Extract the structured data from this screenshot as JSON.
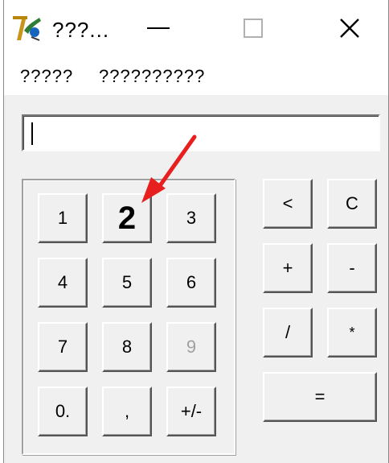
{
  "window": {
    "title": "???...",
    "icon": "app-logo-icon",
    "controls": {
      "minimize": "minimize-icon",
      "maximize": "maximize-icon",
      "close": "close-icon"
    }
  },
  "menubar": {
    "items": [
      "?????",
      "??????????"
    ]
  },
  "display": {
    "value": ""
  },
  "keypad": {
    "digits": [
      "1",
      "2",
      "3",
      "4",
      "5",
      "6",
      "7",
      "8",
      "9",
      "0.",
      ",",
      "+/-"
    ]
  },
  "operators": {
    "backspace": "<",
    "clear": "C",
    "plus": "+",
    "minus": "-",
    "divide": "/",
    "multiply": "*",
    "equals": "="
  },
  "colors": {
    "annotation_arrow": "#e81f1f",
    "window_bg": "#f0f0f0"
  }
}
